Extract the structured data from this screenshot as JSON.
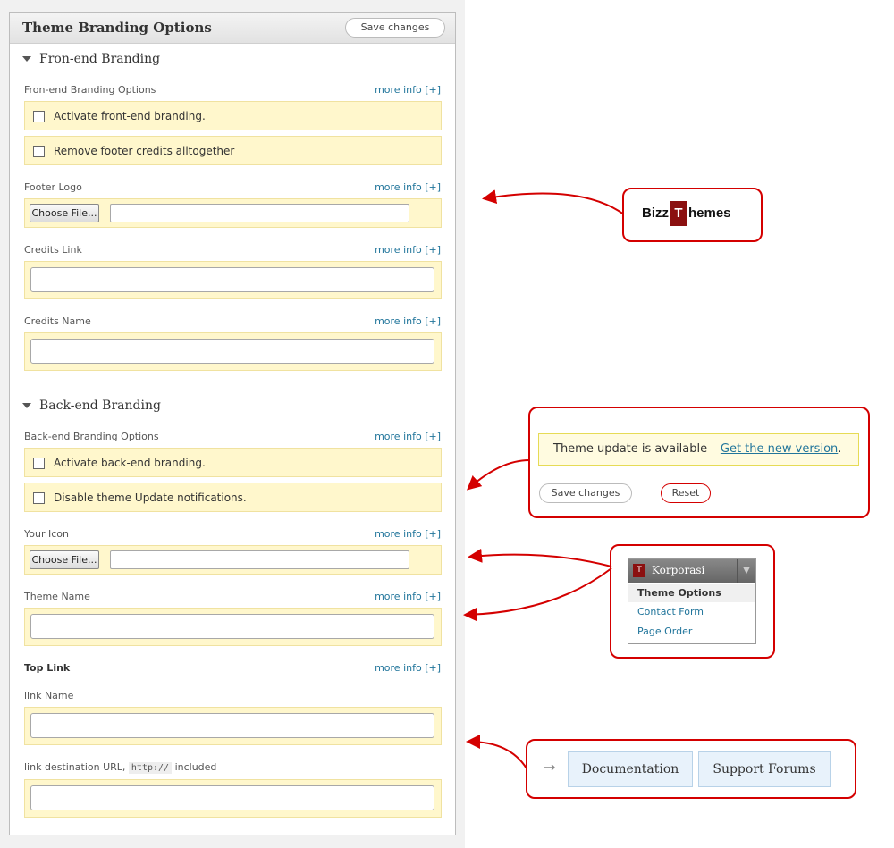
{
  "header": {
    "title": "Theme Branding Options",
    "save_label": "Save changes"
  },
  "frontend": {
    "heading": "Fron-end Branding",
    "options_label": "Fron-end Branding Options",
    "more_info": "more info [+]",
    "activate": "Activate front-end branding.",
    "remove_credits": "Remove footer credits alltogether",
    "footer_logo_label": "Footer Logo",
    "choose_file": "Choose File...",
    "credits_link_label": "Credits Link",
    "credits_name_label": "Credits Name"
  },
  "backend": {
    "heading": "Back-end Branding",
    "options_label": "Back-end Branding Options",
    "activate": "Activate back-end branding.",
    "disable_updates": "Disable theme Update notifications.",
    "your_icon_label": "Your Icon",
    "theme_name_label": "Theme Name",
    "top_link_label": "Top Link",
    "link_name_label": "link Name",
    "link_url_label_pre": "link destination URL,",
    "link_url_code": "http://",
    "link_url_label_post": "included"
  },
  "callouts": {
    "logo": {
      "brand_left": "Bizz",
      "brand_right": "hemes"
    },
    "update": {
      "notice_text": "Theme update is available – ",
      "notice_link": "Get the new version",
      "notice_end": ".",
      "save_label": "Save changes",
      "reset_label": "Reset"
    },
    "menu": {
      "title": "Korporasi",
      "items": [
        "Theme Options",
        "Contact Form",
        "Page Order"
      ]
    },
    "links": {
      "arrow": "→",
      "documentation": "Documentation",
      "support": "Support Forums"
    }
  },
  "colors": {
    "accent": "#d40000",
    "highlight": "#fff7cc",
    "link": "#21759b"
  }
}
